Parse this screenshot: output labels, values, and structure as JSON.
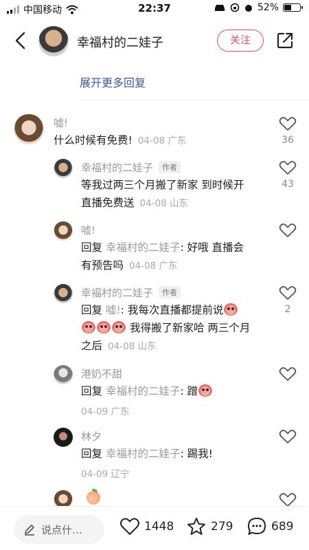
{
  "status_bar": {
    "carrier": "中国移动",
    "time": "22:37",
    "battery": "52%",
    "battery_level": 0.52
  },
  "header": {
    "title": "幸福村的二娃子",
    "follow_label": "关注",
    "back_icon": "chevron-left-icon",
    "share_icon": "share-icon"
  },
  "expand_more": "展开更多回复",
  "comments": [
    {
      "name": "嘘!",
      "text": "什么时候有免费!",
      "meta": "04-08 广东",
      "likes": "36"
    },
    {
      "name": "幸福村的二娃子",
      "author_tag": "作者",
      "line1": "等我过两三个月搬了新家 到时候开",
      "line2": "直播免费送",
      "meta": "04-08 山东",
      "likes": "43"
    },
    {
      "name": "嘘!",
      "reply_prefix": "回复",
      "reply_to": "幸福村的二娃子",
      "line1": ": 好哦 直播会",
      "line2": "有预告吗",
      "meta": "04-08 广东"
    },
    {
      "name": "幸福村的二娃子",
      "author_tag": "作者",
      "reply_prefix": "回复",
      "reply_to": "嘘!",
      "line1": ": 我每次直播都提前说",
      "line2": "我得搬了新家哈 两三个月",
      "line3": "之后",
      "meta": "04-08 山东",
      "likes": "2"
    },
    {
      "name": "港奶不甜",
      "reply_prefix": "回复",
      "reply_to": "幸福村的二娃子",
      "line1": ": 蹭",
      "meta": "04-09 广东"
    },
    {
      "name": "林夕",
      "reply_prefix": "回复",
      "reply_to": "幸福村的二娃子",
      "line1": ": 踢我!",
      "meta": "04-09 辽宁"
    }
  ],
  "bottom_bar": {
    "input_placeholder": "说点什…",
    "likes": "1448",
    "favorites": "279",
    "comments": "689"
  },
  "colors": {
    "accent": "#f24d5b",
    "link": "#3b5999"
  }
}
